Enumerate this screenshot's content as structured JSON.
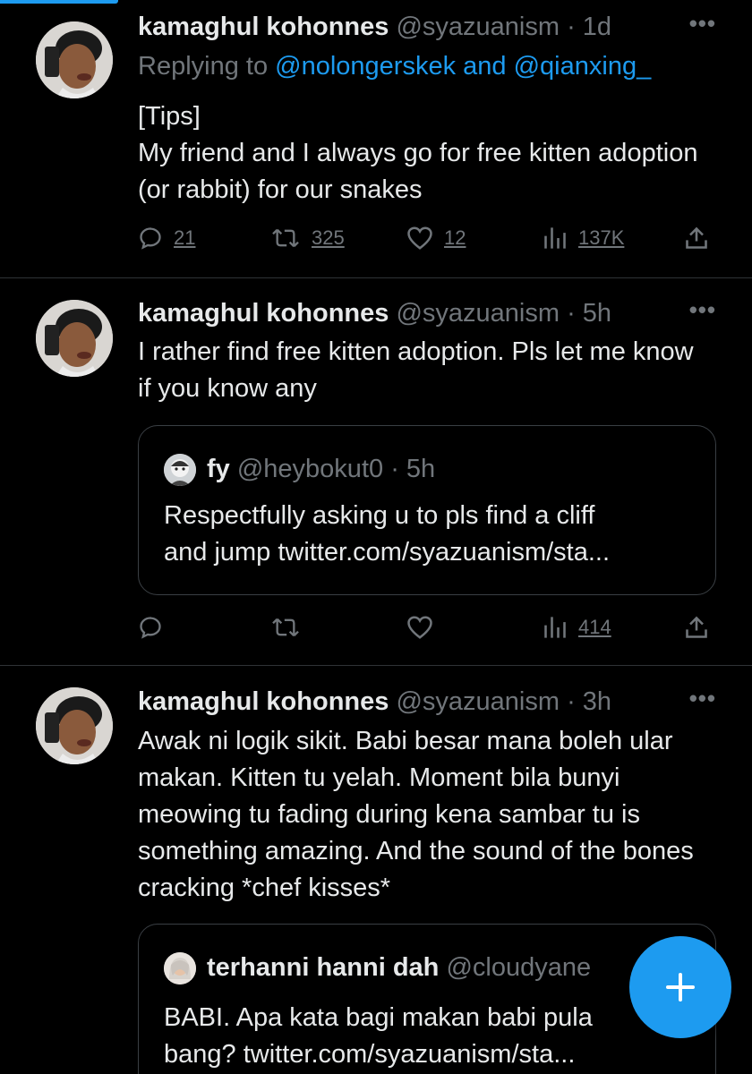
{
  "colors": {
    "background": "#000000",
    "primary_text": "#e7e9ea",
    "secondary_text": "#71767b",
    "accent": "#1d9bf0",
    "divider": "#2f3336"
  },
  "tweets": [
    {
      "name": "kamaghul kohonnes",
      "handle": "@syazuanism",
      "time": "· 1d",
      "more": "•••",
      "replying_prefix": "Replying to ",
      "replying_to_1": "@nolongerskek",
      "replying_and": " and ",
      "replying_to_2": "@qianxing_",
      "text": "[Tips]\nMy friend and I always go for free kitten adoption (or rabbit) for our snakes",
      "replies": "21",
      "retweets": "325",
      "likes": "12",
      "views": "137K",
      "icons": [
        "reply-icon",
        "retweet-icon",
        "like-icon",
        "views-icon",
        "share-icon"
      ]
    },
    {
      "name": "kamaghul kohonnes",
      "handle": "@syazuanism",
      "time": "· 5h",
      "more": "•••",
      "text": "I rather find free kitten adoption. Pls let me know if you know any",
      "quote": {
        "name": "fy",
        "handle": "@heybokut0",
        "time": "· 5h",
        "text": "Respectfully asking u to pls find a cliff\nand jump twitter.com/syazuanism/sta..."
      },
      "views": "414"
    },
    {
      "name": "kamaghul kohonnes",
      "handle": "@syazuanism",
      "time": "· 3h",
      "more": "•••",
      "text": "Awak ni logik sikit. Babi besar mana boleh ular makan. Kitten tu yelah. Moment bila bunyi meowing tu fading during kena sambar tu is something amazing. And the sound of the bones cracking *chef kisses*",
      "quote": {
        "name": "terhanni hanni dah",
        "handle": "@cloudyane",
        "text": "BABI. Apa kata bagi makan babi pula\nbang? twitter.com/syazuanism/sta..."
      }
    }
  ],
  "fab": {
    "icon": "plus-icon"
  }
}
